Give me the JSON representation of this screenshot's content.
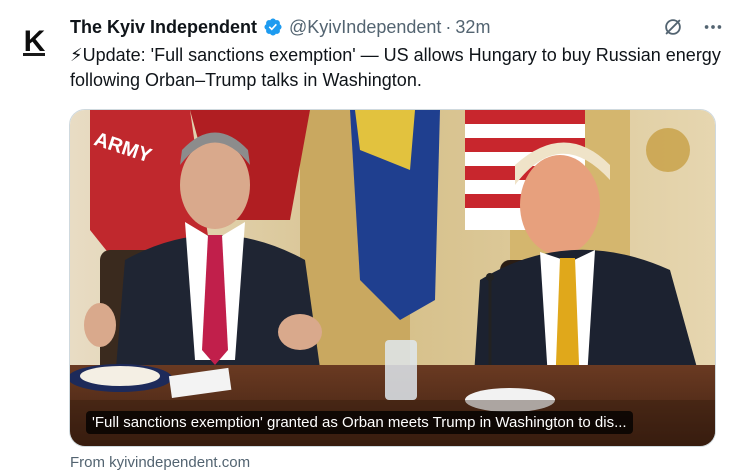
{
  "tweet": {
    "author_name": "The Kyiv Independent",
    "handle": "@KyivIndependent",
    "separator": "·",
    "time": "32m",
    "avatar_letter": "K",
    "text": "⚡Update: 'Full sanctions exemption' — US allows Hungary to buy Russian energy following Orban–Trump talks in Washington.",
    "card_caption": "'Full sanctions exemption' granted as Orban meets Trump in Washington to dis...",
    "source": "From kyivindependent.com"
  },
  "icons": {
    "verified": "verified-badge-icon",
    "grok": "grok-icon",
    "more": "more-icon"
  },
  "colors": {
    "verified_blue": "#1d9bf0",
    "muted_text": "#536471",
    "primary_text": "#0f1419"
  }
}
